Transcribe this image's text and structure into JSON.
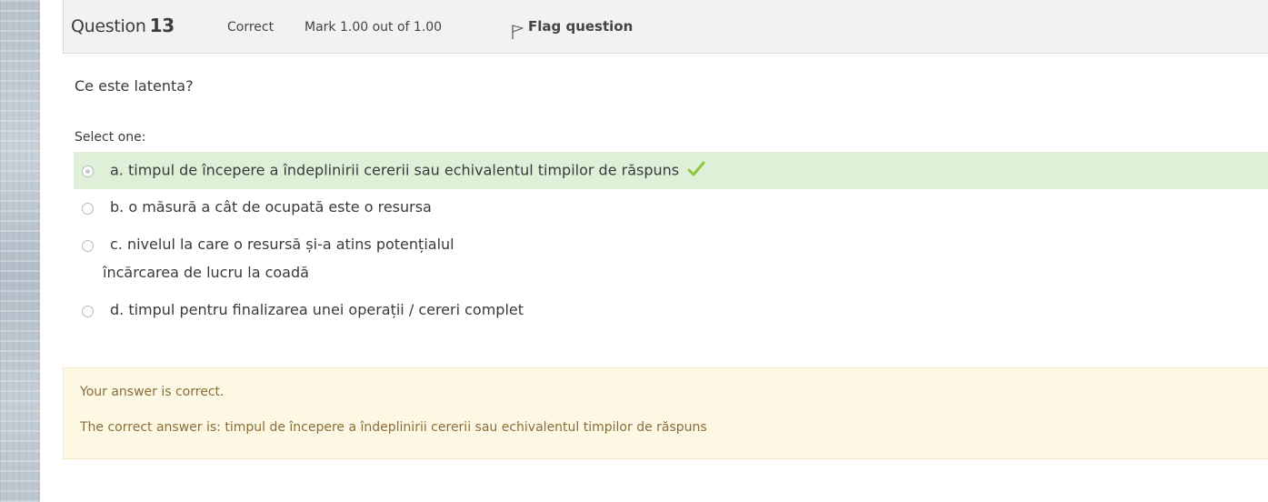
{
  "question": {
    "label": "Question",
    "number": "13",
    "state": "Correct",
    "grade": "Mark 1.00 out of 1.00",
    "flag_label": "Flag question",
    "text": "Ce este latenta?",
    "prompt": "Select one:"
  },
  "answers": [
    {
      "label": "a. timpul de începere a îndeplinirii cererii sau echivalentul timpilor de răspuns",
      "selected": true,
      "correct": true
    },
    {
      "label": "b. o măsură a cât de ocupată este o resursa",
      "selected": false
    },
    {
      "label": "c. nivelul la care o resursă și-a atins potențialul",
      "extra": "încărcarea de lucru la coadă",
      "selected": false
    },
    {
      "label": "d. timpul pentru finalizarea unei operații / cereri complet",
      "selected": false
    }
  ],
  "feedback": {
    "general": "Your answer is correct.",
    "right_answer": "The correct answer is: timpul de începere a îndeplinirii cererii sau echivalentul timpilor de răspuns"
  },
  "colors": {
    "correct_bg": "#dff0d8",
    "tick": "#8dc63f",
    "feedback_bg": "#fcf8e3",
    "feedback_text": "#8a6d3b",
    "info_bg": "#f2f2f2"
  }
}
